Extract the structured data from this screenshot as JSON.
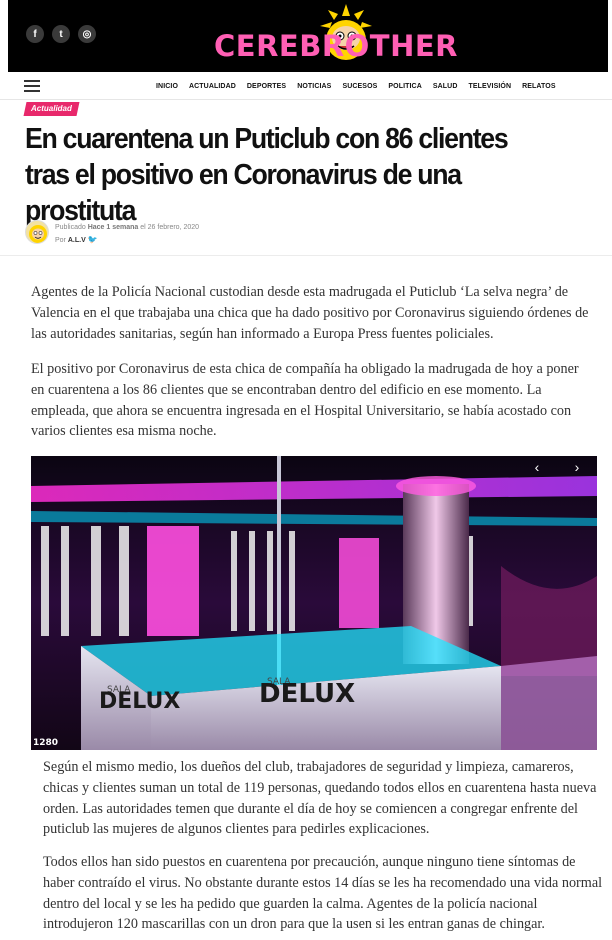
{
  "site": {
    "logo_text": "CEREBROTHER",
    "social": [
      {
        "icon": "facebook-icon",
        "glyph": "f"
      },
      {
        "icon": "twitter-icon",
        "glyph": "t"
      },
      {
        "icon": "instagram-icon",
        "glyph": "◎"
      }
    ]
  },
  "nav": {
    "items": [
      "INICIO",
      "ACTUALIDAD",
      "DEPORTES",
      "NOTICIAS",
      "SUCESOS",
      "POLITICA",
      "SALUD",
      "TELEVISIÓN",
      "RELATOS"
    ]
  },
  "article": {
    "category": "Actualidad",
    "title": "En cuarentena un Puticlub con 86 clientes tras el positivo en Coronavirus de una prostituta",
    "byline": {
      "published_label": "Publicado",
      "relative_time": "Hace 1 semana",
      "date_prefix": "el",
      "date": "26 febrero, 2020",
      "by_label": "Por",
      "author": "A.L.V"
    },
    "paragraphs": [
      "Agentes de la Policía Nacional custodian desde esta madrugada el Puticlub ‘La selva negra’ de Valencia en el que trabajaba una chica que ha dado positivo por Coronavirus siguiendo órdenes de las autoridades sanitarias, según han informado a Europa Press fuentes policiales.",
      "El positivo por Coronavirus de esta chica de compañía ha obligado la madrugada de hoy a poner en cuarentena a los 86 clientes que se encontraban dentro del edificio en ese momento. La empleada, que ahora se encuentra ingresada en el Hospital Universitario, se había acostado con varios clientes esa misma noche.",
      "Según el mismo medio, los dueños del club, trabajadores de seguridad y limpieza, camareros, chicas y clientes suman un total de 119 personas, quedando todos ellos en cuarentena hasta nueva orden. Las autoridades temen que durante el día de hoy se comiencen a congregar enfrente del puticlub las mujeres de algunos clientes para pedirles explicaciones.",
      "Todos ellos han sido puestos en cuarentena por precaución, aunque ninguno tiene síntomas de haber contraído el virus. No obstante durante estos 14 días se les ha recomendado una vida normal dentro del local y se les ha pedido que guarden la calma. Agentes de la policía nacional introdujeron 120 mascarillas con un dron para que la usen si les entran ganas de chingar."
    ],
    "photo": {
      "sign_text_left": "SALA DELUX",
      "sign_text_right": "SALA DELUX",
      "counter": "1280",
      "prev_icon": "chevron-left-icon",
      "next_icon": "chevron-right-icon"
    }
  },
  "colors": {
    "header_bg": "#000000",
    "logo_pink": "#ff5fb4",
    "category_bg": "#e8286b",
    "twitter_blue": "#1da1f2"
  }
}
